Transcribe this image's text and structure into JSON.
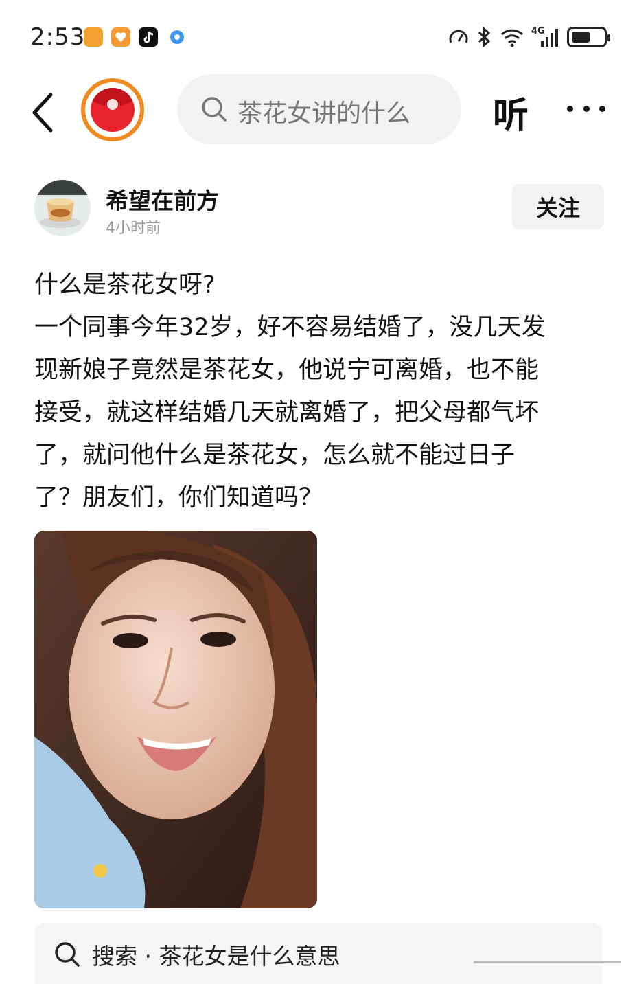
{
  "status_bar": {
    "time": "2:53",
    "network": "4G",
    "battery_percent": 60
  },
  "header": {
    "search_placeholder": "茶花女讲的什么",
    "listen_label": "听"
  },
  "post": {
    "author_name": "希望在前方",
    "time_ago": "4小时前",
    "follow_label": "关注",
    "title_line": "什么是茶花女呀?",
    "lines": [
      "一个同事今年32岁，好不容易结婚了，没几天发",
      "现新娘子竟然是茶花女，他说宁可离婚，也不能",
      "接受，就这样结婚几天就离婚了，把父母都气坏",
      "了，就问他什么是茶花女，怎么就不能过日子",
      "了？朋友们，你们知道吗？"
    ]
  },
  "related_search": {
    "label": "搜索 · 茶花女是什么意思"
  },
  "colors": {
    "accent_orange": "#f08a1e",
    "red": "#e8232d",
    "search_bg": "#f1f2f4"
  }
}
